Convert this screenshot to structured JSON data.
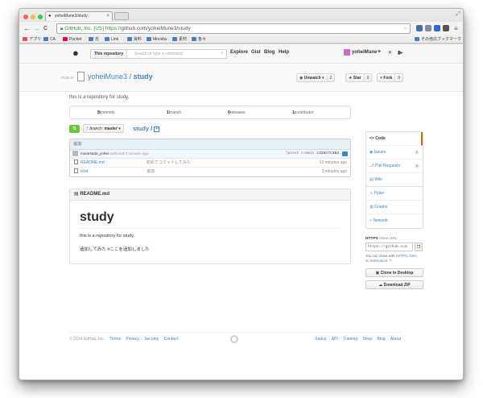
{
  "browser": {
    "tab_title": "yoheiMune3/study",
    "tab_close": "×",
    "nav_back": "←",
    "nav_forward": "→",
    "nav_reload": "C",
    "url_secure": "GitHub, Inc. [US]",
    "url_scheme": "https://",
    "url_rest": "github.com/yoheiMune3/study",
    "bookmarks": [
      "アプリ",
      "CA",
      "Pocket",
      "氏",
      "Link",
      "資料",
      "Mockbu",
      "素材",
      "各々"
    ],
    "other_bookmarks": "その他のブックマーク"
  },
  "github_header": {
    "scope": "This repository",
    "search_placeholder": "Search or type a command",
    "nav": [
      "Explore",
      "Gist",
      "Blog",
      "Help"
    ],
    "username": "yoheiMune",
    "plus": "+",
    "tools": "✕",
    "signout": "▮▸"
  },
  "repo": {
    "visibility": "PUBLIC",
    "owner": "yoheiMune3",
    "separator": "/",
    "name": "study",
    "unwatch_label": "Unwatch",
    "watch_count": "2",
    "star_label": "Star",
    "star_count": "0",
    "fork_label": "Fork",
    "fork_count": "0",
    "description": "this is a repository for study."
  },
  "numbers": {
    "commits_count": "5",
    "commits_label": "commits",
    "branch_count": "1",
    "branch_label": "branch",
    "releases_count": "0",
    "releases_label": "releases",
    "contributor_count": "1",
    "contributor_label": "contributor"
  },
  "file_nav": {
    "branch_prefix": "branch:",
    "branch": "master",
    "path_repo": "study",
    "path_sep": "/",
    "path_add": "+"
  },
  "commit": {
    "message": "追加",
    "author": "munesada_yohei",
    "time_text": "authored 3 minutes ago",
    "latest_label": "latest commit",
    "sha": "c429c7c383"
  },
  "files": [
    {
      "name": "README.md",
      "message": "初めてコミットしてみた",
      "age": "13 minutes ago"
    },
    {
      "name": "a.txt",
      "message": "追加",
      "age": "3 minutes ago"
    }
  ],
  "readme": {
    "filename": "README.md",
    "heading": "study",
    "para1": "this is a repository for study.",
    "para2": "追加してみた #ここを追加しました"
  },
  "sidebar": {
    "items": [
      {
        "label": "Code",
        "badge": ""
      },
      {
        "label": "Issues",
        "badge": "0"
      },
      {
        "label": "Pull Requests",
        "badge": "0"
      },
      {
        "label": "Wiki",
        "badge": ""
      },
      {
        "label": "Pulse",
        "badge": ""
      },
      {
        "label": "Graphs",
        "badge": ""
      },
      {
        "label": "Network",
        "badge": ""
      }
    ],
    "clone_title": "HTTPS",
    "clone_sub": "clone URL",
    "clone_url": "https://github.com",
    "clone_help_1": "You can clone with",
    "clone_help_links": "HTTPS, SSH,",
    "clone_help_2": "or",
    "clone_help_sub": "Subversion.",
    "clone_desktop": "Clone in Desktop",
    "download_zip": "Download ZIP"
  },
  "footer": {
    "copyright": "© 2014 GitHub, Inc.",
    "left_links": [
      "Terms",
      "Privacy",
      "Security",
      "Contact"
    ],
    "right_links": [
      "Status",
      "API",
      "Training",
      "Shop",
      "Blog",
      "About"
    ]
  },
  "colors": {
    "link": "#4183c4",
    "green": "#6cc644",
    "commit_bg": "#e6f1f6",
    "selected_border": "#d26911"
  }
}
